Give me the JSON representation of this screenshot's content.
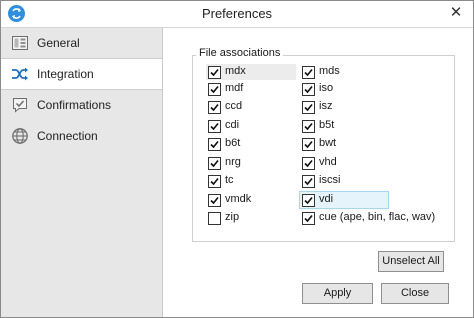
{
  "window": {
    "title": "Preferences",
    "close_glyph": "✕",
    "app_icon": "refresh-arrows-icon"
  },
  "sidebar": {
    "items": [
      {
        "label": "General",
        "icon": "general-panel-icon",
        "selected": false
      },
      {
        "label": "Integration",
        "icon": "shuffle-icon",
        "selected": true
      },
      {
        "label": "Confirmations",
        "icon": "confirmation-icon",
        "selected": false
      },
      {
        "label": "Connection",
        "icon": "globe-icon",
        "selected": false
      }
    ]
  },
  "file_associations": {
    "title": "File associations",
    "left": [
      {
        "label": "mdx",
        "checked": true
      },
      {
        "label": "mdf",
        "checked": true
      },
      {
        "label": "ccd",
        "checked": true
      },
      {
        "label": "cdi",
        "checked": true
      },
      {
        "label": "b6t",
        "checked": true
      },
      {
        "label": "nrg",
        "checked": true
      },
      {
        "label": "tc",
        "checked": true
      },
      {
        "label": "vmdk",
        "checked": true
      },
      {
        "label": "zip",
        "checked": false
      }
    ],
    "right": [
      {
        "label": "mds",
        "checked": true
      },
      {
        "label": "iso",
        "checked": true
      },
      {
        "label": "isz",
        "checked": true
      },
      {
        "label": "b5t",
        "checked": true
      },
      {
        "label": "bwt",
        "checked": true
      },
      {
        "label": "vhd",
        "checked": true
      },
      {
        "label": "iscsi",
        "checked": true
      },
      {
        "label": "vdi",
        "checked": true
      },
      {
        "label": "cue (ape, bin, flac, wav)",
        "checked": true
      }
    ]
  },
  "buttons": {
    "unselect_all": "Unselect All",
    "apply": "Apply",
    "close": "Close"
  }
}
